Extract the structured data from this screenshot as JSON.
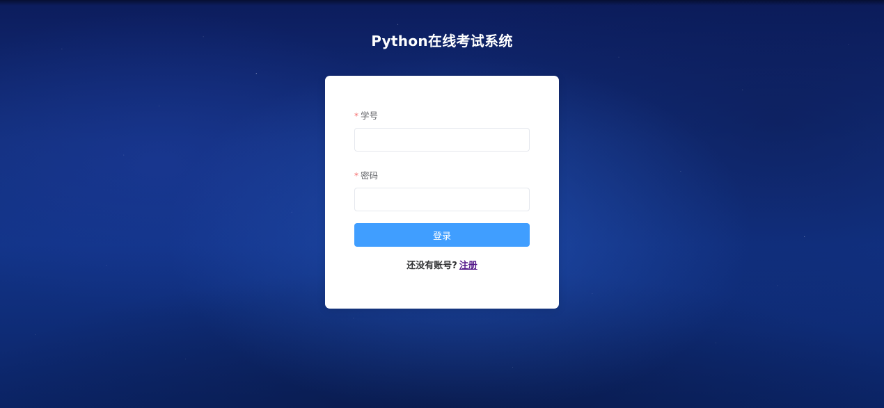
{
  "page": {
    "title": "Python在线考试系统"
  },
  "login_form": {
    "username_label": "学号",
    "username_value": "",
    "password_label": "密码",
    "password_value": "",
    "required_marker": "*",
    "submit_label": "登录"
  },
  "register": {
    "prompt": "还没有账号?",
    "link_label": "注册"
  },
  "colors": {
    "primary_button": "#409eff",
    "required_star": "#f56c6c",
    "link": "#551a8b",
    "background": "#13307e"
  }
}
